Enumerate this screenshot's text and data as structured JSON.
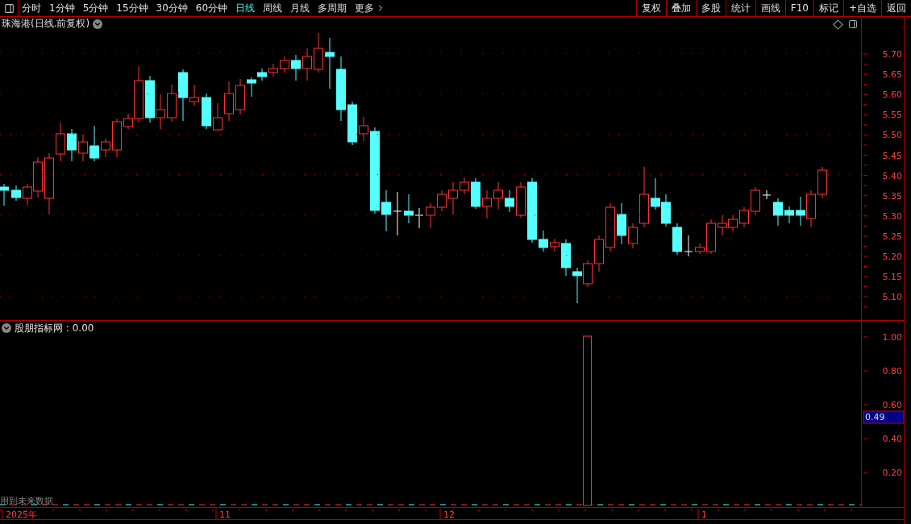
{
  "toolbar": {
    "periods": [
      {
        "label": "分时",
        "selected": false
      },
      {
        "label": "1分钟",
        "selected": false
      },
      {
        "label": "5分钟",
        "selected": false
      },
      {
        "label": "15分钟",
        "selected": false
      },
      {
        "label": "30分钟",
        "selected": false
      },
      {
        "label": "60分钟",
        "selected": false
      },
      {
        "label": "日线",
        "selected": true
      },
      {
        "label": "周线",
        "selected": false
      },
      {
        "label": "月线",
        "selected": false
      },
      {
        "label": "多周期",
        "selected": false
      }
    ],
    "more": "更多",
    "actions": [
      "复权",
      "叠加",
      "多股",
      "统计",
      "画线",
      "F10",
      "标记",
      "+自选",
      "返回"
    ]
  },
  "chart": {
    "title": "珠海港(日线.前复权)",
    "price_axis": [
      "5.70",
      "5.65",
      "5.60",
      "5.55",
      "5.50",
      "5.45",
      "5.40",
      "5.35",
      "5.30",
      "5.25",
      "5.20",
      "5.15",
      "5.10"
    ]
  },
  "indicator": {
    "name": "股朋指标网",
    "value": ": 0.00",
    "axis": [
      "1.00",
      "0.80",
      "0.60",
      "0.40",
      "0.20"
    ],
    "current": "0.49",
    "warning": "用到未来数据"
  },
  "time_axis": [
    "2025年",
    "11",
    "12",
    "1"
  ]
}
